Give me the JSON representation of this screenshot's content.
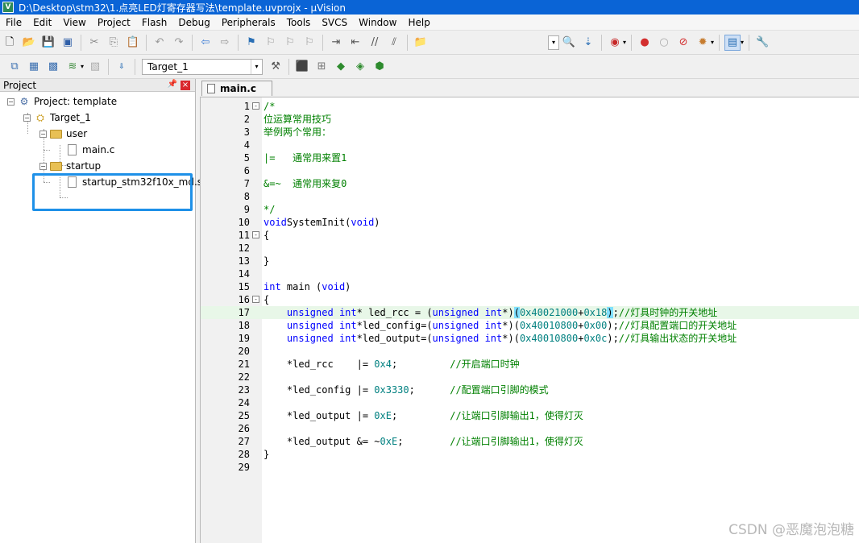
{
  "window": {
    "title": "D:\\Desktop\\stm32\\1.点亮LED灯寄存器写法\\template.uvprojx - µVision",
    "app_icon_letter": "V"
  },
  "menu": [
    "File",
    "Edit",
    "View",
    "Project",
    "Flash",
    "Debug",
    "Peripherals",
    "Tools",
    "SVCS",
    "Window",
    "Help"
  ],
  "toolbar2": {
    "target_selected": "Target_1"
  },
  "project_panel": {
    "title": "Project",
    "tree": {
      "project": "Project: template",
      "target": "Target_1",
      "group_user": "user",
      "file_main": "main.c",
      "group_startup": "startup",
      "file_startup": "startup_stm32f10x_md.s"
    }
  },
  "editor": {
    "tab": "main.c",
    "lines": [
      {
        "n": "1",
        "fold": "-",
        "segs": [
          [
            "cm",
            "/*"
          ]
        ]
      },
      {
        "n": "2",
        "segs": [
          [
            "cm",
            "位运算常用技巧"
          ]
        ]
      },
      {
        "n": "3",
        "segs": [
          [
            "cm",
            "举例两个常用："
          ]
        ]
      },
      {
        "n": "4",
        "segs": []
      },
      {
        "n": "5",
        "segs": [
          [
            "cm",
            "|=   通常用来置1"
          ]
        ]
      },
      {
        "n": "6",
        "segs": []
      },
      {
        "n": "7",
        "segs": [
          [
            "cm",
            "&=~  通常用来复0"
          ]
        ]
      },
      {
        "n": "8",
        "segs": []
      },
      {
        "n": "9",
        "segs": [
          [
            "cm",
            "*/"
          ]
        ]
      },
      {
        "n": "10",
        "segs": [
          [
            "kw",
            "void"
          ],
          [
            "",
            "SystemInit("
          ],
          [
            "kw",
            "void"
          ],
          [
            "",
            ")"
          ]
        ]
      },
      {
        "n": "11",
        "fold": "-",
        "segs": [
          [
            "",
            "{"
          ]
        ]
      },
      {
        "n": "12",
        "segs": []
      },
      {
        "n": "13",
        "segs": [
          [
            "",
            "}"
          ]
        ]
      },
      {
        "n": "14",
        "segs": []
      },
      {
        "n": "15",
        "segs": [
          [
            "kw",
            "int"
          ],
          [
            "",
            " main ("
          ],
          [
            "kw",
            "void"
          ],
          [
            "",
            ")"
          ]
        ]
      },
      {
        "n": "16",
        "fold": "-",
        "segs": [
          [
            "",
            "{"
          ]
        ]
      },
      {
        "n": "17",
        "current": true,
        "segs": [
          [
            "",
            "    "
          ],
          [
            "kw",
            "unsigned"
          ],
          [
            "",
            " "
          ],
          [
            "kw",
            "int"
          ],
          [
            "",
            "* led_rcc = ("
          ],
          [
            "kw",
            "unsigned"
          ],
          [
            "",
            " "
          ],
          [
            "kw",
            "int"
          ],
          [
            "",
            "*)"
          ],
          [
            "hl",
            "("
          ],
          [
            "num",
            "0x40021000"
          ],
          [
            "",
            "+"
          ],
          [
            "num",
            "0x18"
          ],
          [
            "hl",
            ")"
          ],
          [
            "",
            ";"
          ],
          [
            "cm",
            "//灯具时钟的开关地址"
          ]
        ]
      },
      {
        "n": "18",
        "segs": [
          [
            "",
            "    "
          ],
          [
            "kw",
            "unsigned"
          ],
          [
            "",
            " "
          ],
          [
            "kw",
            "int"
          ],
          [
            "",
            "*led_config=("
          ],
          [
            "kw",
            "unsigned"
          ],
          [
            "",
            " "
          ],
          [
            "kw",
            "int"
          ],
          [
            "",
            "*)("
          ],
          [
            "num",
            "0x40010800"
          ],
          [
            "",
            "+"
          ],
          [
            "num",
            "0x00"
          ],
          [
            "",
            ");"
          ],
          [
            "cm",
            "//灯具配置端口的开关地址"
          ]
        ]
      },
      {
        "n": "19",
        "segs": [
          [
            "",
            "    "
          ],
          [
            "kw",
            "unsigned"
          ],
          [
            "",
            " "
          ],
          [
            "kw",
            "int"
          ],
          [
            "",
            "*led_output=("
          ],
          [
            "kw",
            "unsigned"
          ],
          [
            "",
            " "
          ],
          [
            "kw",
            "int"
          ],
          [
            "",
            "*)("
          ],
          [
            "num",
            "0x40010800"
          ],
          [
            "",
            "+"
          ],
          [
            "num",
            "0x0c"
          ],
          [
            "",
            ");"
          ],
          [
            "cm",
            "//灯具输出状态的开关地址"
          ]
        ]
      },
      {
        "n": "20",
        "segs": []
      },
      {
        "n": "21",
        "segs": [
          [
            "",
            "    *led_rcc    |= "
          ],
          [
            "num",
            "0x4"
          ],
          [
            "",
            ";         "
          ],
          [
            "cm",
            "//开启端口时钟"
          ]
        ]
      },
      {
        "n": "22",
        "segs": []
      },
      {
        "n": "23",
        "segs": [
          [
            "",
            "    *led_config |= "
          ],
          [
            "num",
            "0x3330"
          ],
          [
            "",
            ";      "
          ],
          [
            "cm",
            "//配置端口引脚的模式"
          ]
        ]
      },
      {
        "n": "24",
        "segs": []
      },
      {
        "n": "25",
        "segs": [
          [
            "",
            "    *led_output |= "
          ],
          [
            "num",
            "0xE"
          ],
          [
            "",
            ";         "
          ],
          [
            "cm",
            "//让端口引脚输出1，使得灯灭"
          ]
        ]
      },
      {
        "n": "26",
        "segs": []
      },
      {
        "n": "27",
        "segs": [
          [
            "",
            "    *led_output &= ~"
          ],
          [
            "num",
            "0xE"
          ],
          [
            "",
            ";        "
          ],
          [
            "cm",
            "//让端口引脚输出1，使得灯灭"
          ]
        ]
      },
      {
        "n": "28",
        "segs": [
          [
            "",
            "}"
          ]
        ]
      },
      {
        "n": "29",
        "segs": []
      }
    ]
  },
  "watermark": "CSDN @恶魔泡泡糖",
  "colors": {
    "keyword": "#0000ff",
    "comment": "#008000",
    "number": "#008080",
    "current_line": "#e8f7e8",
    "brace_match": "#80e0ff",
    "selection_box": "#1e90e8"
  }
}
